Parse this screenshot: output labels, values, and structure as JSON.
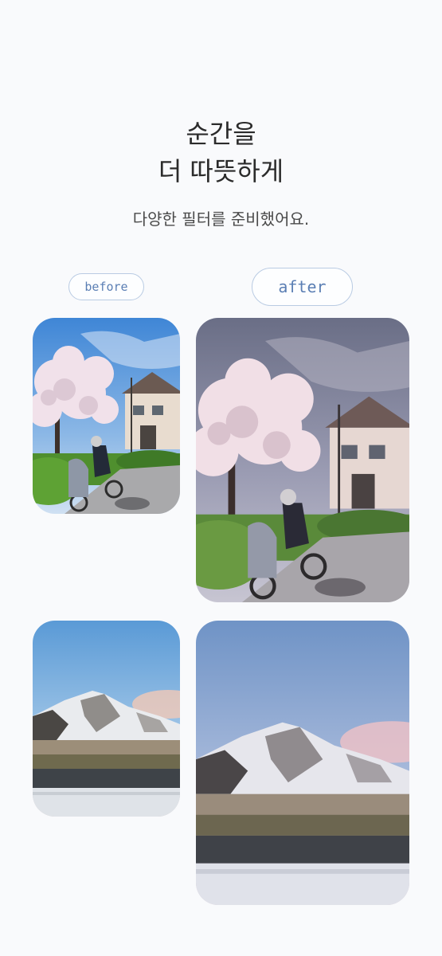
{
  "title": {
    "line1": "순간을",
    "line2": "더 따뜻하게"
  },
  "subtitle": "다양한 필터를 준비했어요.",
  "labels": {
    "before": "before",
    "after": "after"
  },
  "colors": {
    "pill_border": "#b9cbe3",
    "pill_text": "#5b7fb4",
    "background": "#f9fafc"
  },
  "photos": [
    {
      "scene": "cherry-blossom-cyclist",
      "variant": "before"
    },
    {
      "scene": "cherry-blossom-cyclist",
      "variant": "after"
    },
    {
      "scene": "snowy-mountain-river",
      "variant": "before"
    },
    {
      "scene": "snowy-mountain-river",
      "variant": "after"
    }
  ]
}
